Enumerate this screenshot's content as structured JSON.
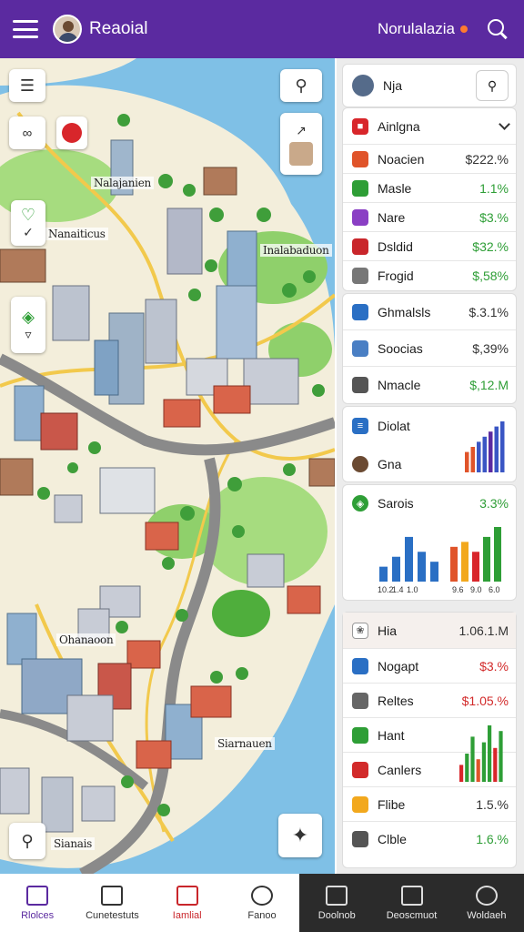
{
  "header": {
    "app_title": "Reaoial",
    "user_name": "Norulalazia"
  },
  "map": {
    "labels": [
      "Nalajanien",
      "Nanaiticus",
      "Inalabaduon",
      "Ohanaoon",
      "Siarnauen",
      "Sianais"
    ],
    "colors": {
      "water": "#7fc0e6",
      "land": "#f3eedb",
      "park": "#8fd06b",
      "road": "#888888",
      "highway": "#f2c94c"
    }
  },
  "panel": {
    "header": {
      "name": "Nja"
    },
    "section": {
      "title": "Ainlgna"
    },
    "items": [
      {
        "label": "Noacien",
        "value": "$222.%",
        "tone": "dark",
        "icon": "target-icon",
        "color": "#e0542a"
      },
      {
        "label": "Masle",
        "value": "1.1%",
        "tone": "green",
        "icon": "dot-icon",
        "color": "#2e9e36"
      },
      {
        "label": "Nare",
        "value": "$3.%",
        "tone": "green",
        "icon": "heart-icon",
        "color": "#8a3fc4"
      },
      {
        "label": "Dsldid",
        "value": "$32.%",
        "tone": "green",
        "icon": "graduation-icon",
        "color": "#c9262b"
      },
      {
        "label": "Frogid",
        "value": "$,58%",
        "tone": "green",
        "icon": "box-icon",
        "color": "#777777"
      }
    ],
    "items2": [
      {
        "label": "Ghmalsls",
        "value": "$.3.1%",
        "tone": "dark",
        "icon": "globe-icon",
        "color": "#2a6fc4"
      },
      {
        "label": "Soocias",
        "value": "$,39%",
        "tone": "dark",
        "icon": "card-icon",
        "color": "#4a7fc4"
      },
      {
        "label": "Nmacle",
        "value": "$,12.M",
        "tone": "green",
        "icon": "cloud-icon",
        "color": "#555555"
      }
    ],
    "chart_group": {
      "row1": {
        "label": "Diolat",
        "icon": "stack-icon"
      },
      "row2": {
        "label": "Gna",
        "icon": "person-icon"
      },
      "chart_data": {
        "type": "bar",
        "values": [
          4,
          5,
          6,
          7,
          8,
          9,
          10
        ]
      }
    },
    "savings": {
      "label": "Sarois",
      "value": "3.3%",
      "icon": "leaf-icon",
      "chart_data": {
        "type": "bar",
        "series": [
          {
            "values": [
              3,
              5,
              9,
              6,
              4
            ]
          },
          {
            "values": [
              7,
              8,
              6,
              9,
              11
            ]
          }
        ]
      },
      "tick_labels_left": [
        "10.2",
        "1.4",
        "1.0"
      ],
      "tick_labels_right": [
        "9.6",
        "9.0",
        "6.0"
      ]
    },
    "lower_header": {
      "label": "Hia",
      "value": "1.06.1.M",
      "icon": "figure-icon"
    },
    "lower_items": [
      {
        "label": "Nogapt",
        "value": "$3.%",
        "tone": "red",
        "icon": "chart-icon",
        "color": "#2a6fc4"
      },
      {
        "label": "Reltes",
        "value": "$1.05.%",
        "tone": "red",
        "icon": "doc-icon",
        "color": "#666666"
      },
      {
        "label": "Hant",
        "value": "",
        "tone": "dark",
        "icon": "leaf-icon",
        "color": "#2e9e36"
      },
      {
        "label": "Canlers",
        "value": "",
        "tone": "dark",
        "icon": "ring-icon",
        "color": "#d22a2a"
      },
      {
        "label": "Flibe",
        "value": "1.5.%",
        "tone": "dark",
        "icon": "flag-icon",
        "color": "#f2a81d"
      },
      {
        "label": "Clble",
        "value": "1.6.%",
        "tone": "green",
        "icon": "db-icon",
        "color": "#555555"
      }
    ],
    "lower_chart": {
      "chart_data": {
        "type": "bar",
        "values": [
          3,
          5,
          8,
          4,
          7,
          10,
          6,
          9
        ]
      }
    }
  },
  "bottom_nav": [
    {
      "label": "Rlolces",
      "icon": "home-icon",
      "active": true
    },
    {
      "label": "Cunetestuts",
      "icon": "box-icon"
    },
    {
      "label": "Iamlial",
      "icon": "store-icon"
    },
    {
      "label": "Fanoo",
      "icon": "circle-icon"
    },
    {
      "label": "Doolnob",
      "icon": "shield-icon"
    },
    {
      "label": "Deoscmuot",
      "icon": "house-icon"
    },
    {
      "label": "Woldaeh",
      "icon": "settings-icon"
    }
  ]
}
